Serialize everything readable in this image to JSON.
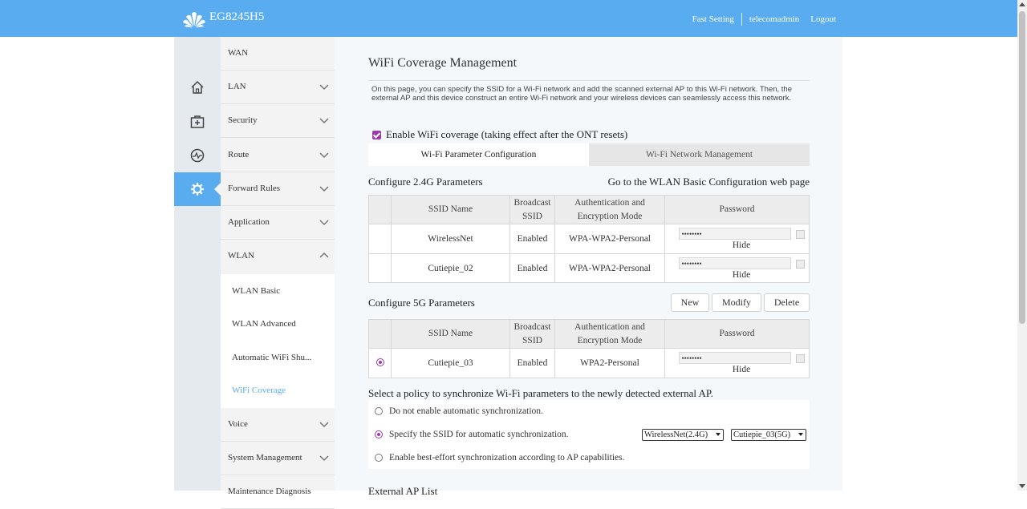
{
  "header": {
    "model": "EG8245H5",
    "fast_setting": "Fast Setting",
    "user": "telecomadmin",
    "logout": "Logout"
  },
  "rail": {
    "icons": [
      "home-icon",
      "plus-box-icon",
      "pulse-icon",
      "gear-icon"
    ],
    "active_index": 3
  },
  "menu": {
    "items": [
      {
        "label": "WAN"
      },
      {
        "label": "LAN"
      },
      {
        "label": "Security"
      },
      {
        "label": "Route"
      },
      {
        "label": "Forward Rules"
      },
      {
        "label": "Application"
      },
      {
        "label": "WLAN"
      },
      {
        "label": "Voice"
      },
      {
        "label": "System Management"
      },
      {
        "label": "Maintenance Diagnosis"
      }
    ],
    "wlan_sub": [
      "WLAN Basic",
      "WLAN Advanced",
      "Automatic WiFi Shu...",
      "WiFi Coverage"
    ]
  },
  "page": {
    "title": "WiFi Coverage Management",
    "description": "On this page, you can specify the SSID for a Wi-Fi network and add the scanned external AP to this Wi-Fi network. Then, the external AP and this device construct an entire Wi-Fi network and your wireless devices can seamlessly access this network.",
    "enable_label": "Enable WiFi coverage (taking effect after the ONT resets)",
    "enable_checked": true,
    "tabs": [
      "Wi-Fi Parameter Configuration",
      "Wi-Fi Network Management"
    ],
    "active_tab": 0
  },
  "g24": {
    "title": "Configure 2.4G Parameters",
    "link": "Go to the WLAN Basic Configuration web page",
    "headers": [
      "SSID Name",
      "Broadcast SSID",
      "Authentication and Encryption Mode",
      "Password"
    ],
    "rows": [
      {
        "ssid": "WirelessNet",
        "broadcast": "Enabled",
        "auth": "WPA-WPA2-Personal",
        "password": "••••••••",
        "hide": "Hide"
      },
      {
        "ssid": "Cutiepie_02",
        "broadcast": "Enabled",
        "auth": "WPA-WPA2-Personal",
        "password": "••••••••",
        "hide": "Hide"
      }
    ]
  },
  "g5": {
    "title": "Configure 5G Parameters",
    "buttons": {
      "new": "New",
      "modify": "Modify",
      "delete": "Delete"
    },
    "headers": [
      "SSID Name",
      "Broadcast SSID",
      "Authentication and Encryption Mode",
      "Password"
    ],
    "rows": [
      {
        "ssid": "Cutiepie_03",
        "broadcast": "Enabled",
        "auth": "WPA2-Personal",
        "password": "••••••••",
        "hide": "Hide",
        "selected": true
      }
    ]
  },
  "policy": {
    "title": "Select a policy to synchronize Wi-Fi parameters to the newly detected external AP.",
    "options": [
      "Do not enable automatic synchronization.",
      "Specify the SSID for automatic synchronization.",
      "Enable best-effort synchronization according to AP capabilities."
    ],
    "selected": 1,
    "select_24g": "WirelessNet(2.4G)",
    "select_5g": "Cutiepie_03(5G)"
  },
  "next_heading": "External AP List"
}
